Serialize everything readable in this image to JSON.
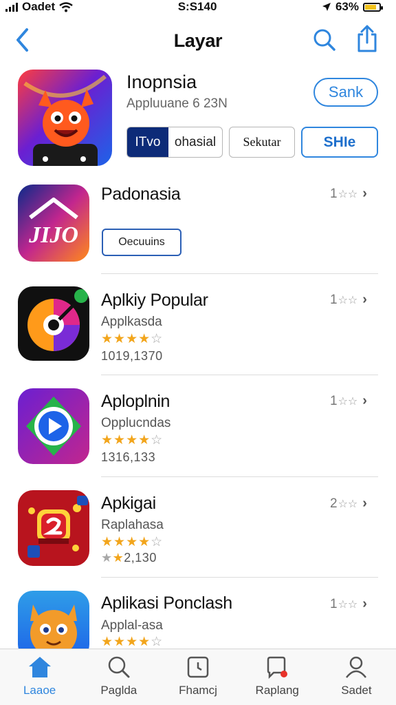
{
  "status_bar": {
    "carrier": "Oadet",
    "time": "S:S140",
    "battery": "63%"
  },
  "nav": {
    "title": "Layar"
  },
  "featured": {
    "name": "Inopnsia",
    "subtitle": "Appluuane 6 23N",
    "get_label": "Sank",
    "segment": {
      "active": "ITvo",
      "inactive": "ohasial"
    },
    "button_secondary": "Sekutar",
    "button_primary": "SHIe"
  },
  "apps": [
    {
      "title": "Padonasia",
      "rank": "1",
      "details_label": "Oecuuins",
      "icon_text": "JIJO"
    },
    {
      "title": "Aplkiy Popular",
      "subtitle": "Applkasda",
      "stars": 4,
      "count": "1019,1370",
      "rank": "1"
    },
    {
      "title": "Aploplnin",
      "subtitle": "Opplucndas",
      "stars": 4,
      "count": "1316,133",
      "rank": "1"
    },
    {
      "title": "Apkigai",
      "subtitle": "Raplahasa",
      "stars": 4,
      "count": "2,130",
      "count_stars": 2,
      "rank": "2"
    },
    {
      "title": "Aplikasi Ponclash",
      "subtitle": "Applal-asa",
      "stars": 4,
      "rank": "1"
    }
  ],
  "tabs": [
    {
      "label": "Laaoe",
      "icon": "home-icon",
      "active": true
    },
    {
      "label": "Paglda",
      "icon": "search-icon"
    },
    {
      "label": "Fhamcj",
      "icon": "calendar-clock-icon"
    },
    {
      "label": "Raplang",
      "icon": "notification-icon"
    },
    {
      "label": "Sadet",
      "icon": "profile-icon"
    }
  ],
  "colors": {
    "accent": "#2f86de",
    "star": "#f2a51c",
    "segment_active": "#0d2b78"
  }
}
